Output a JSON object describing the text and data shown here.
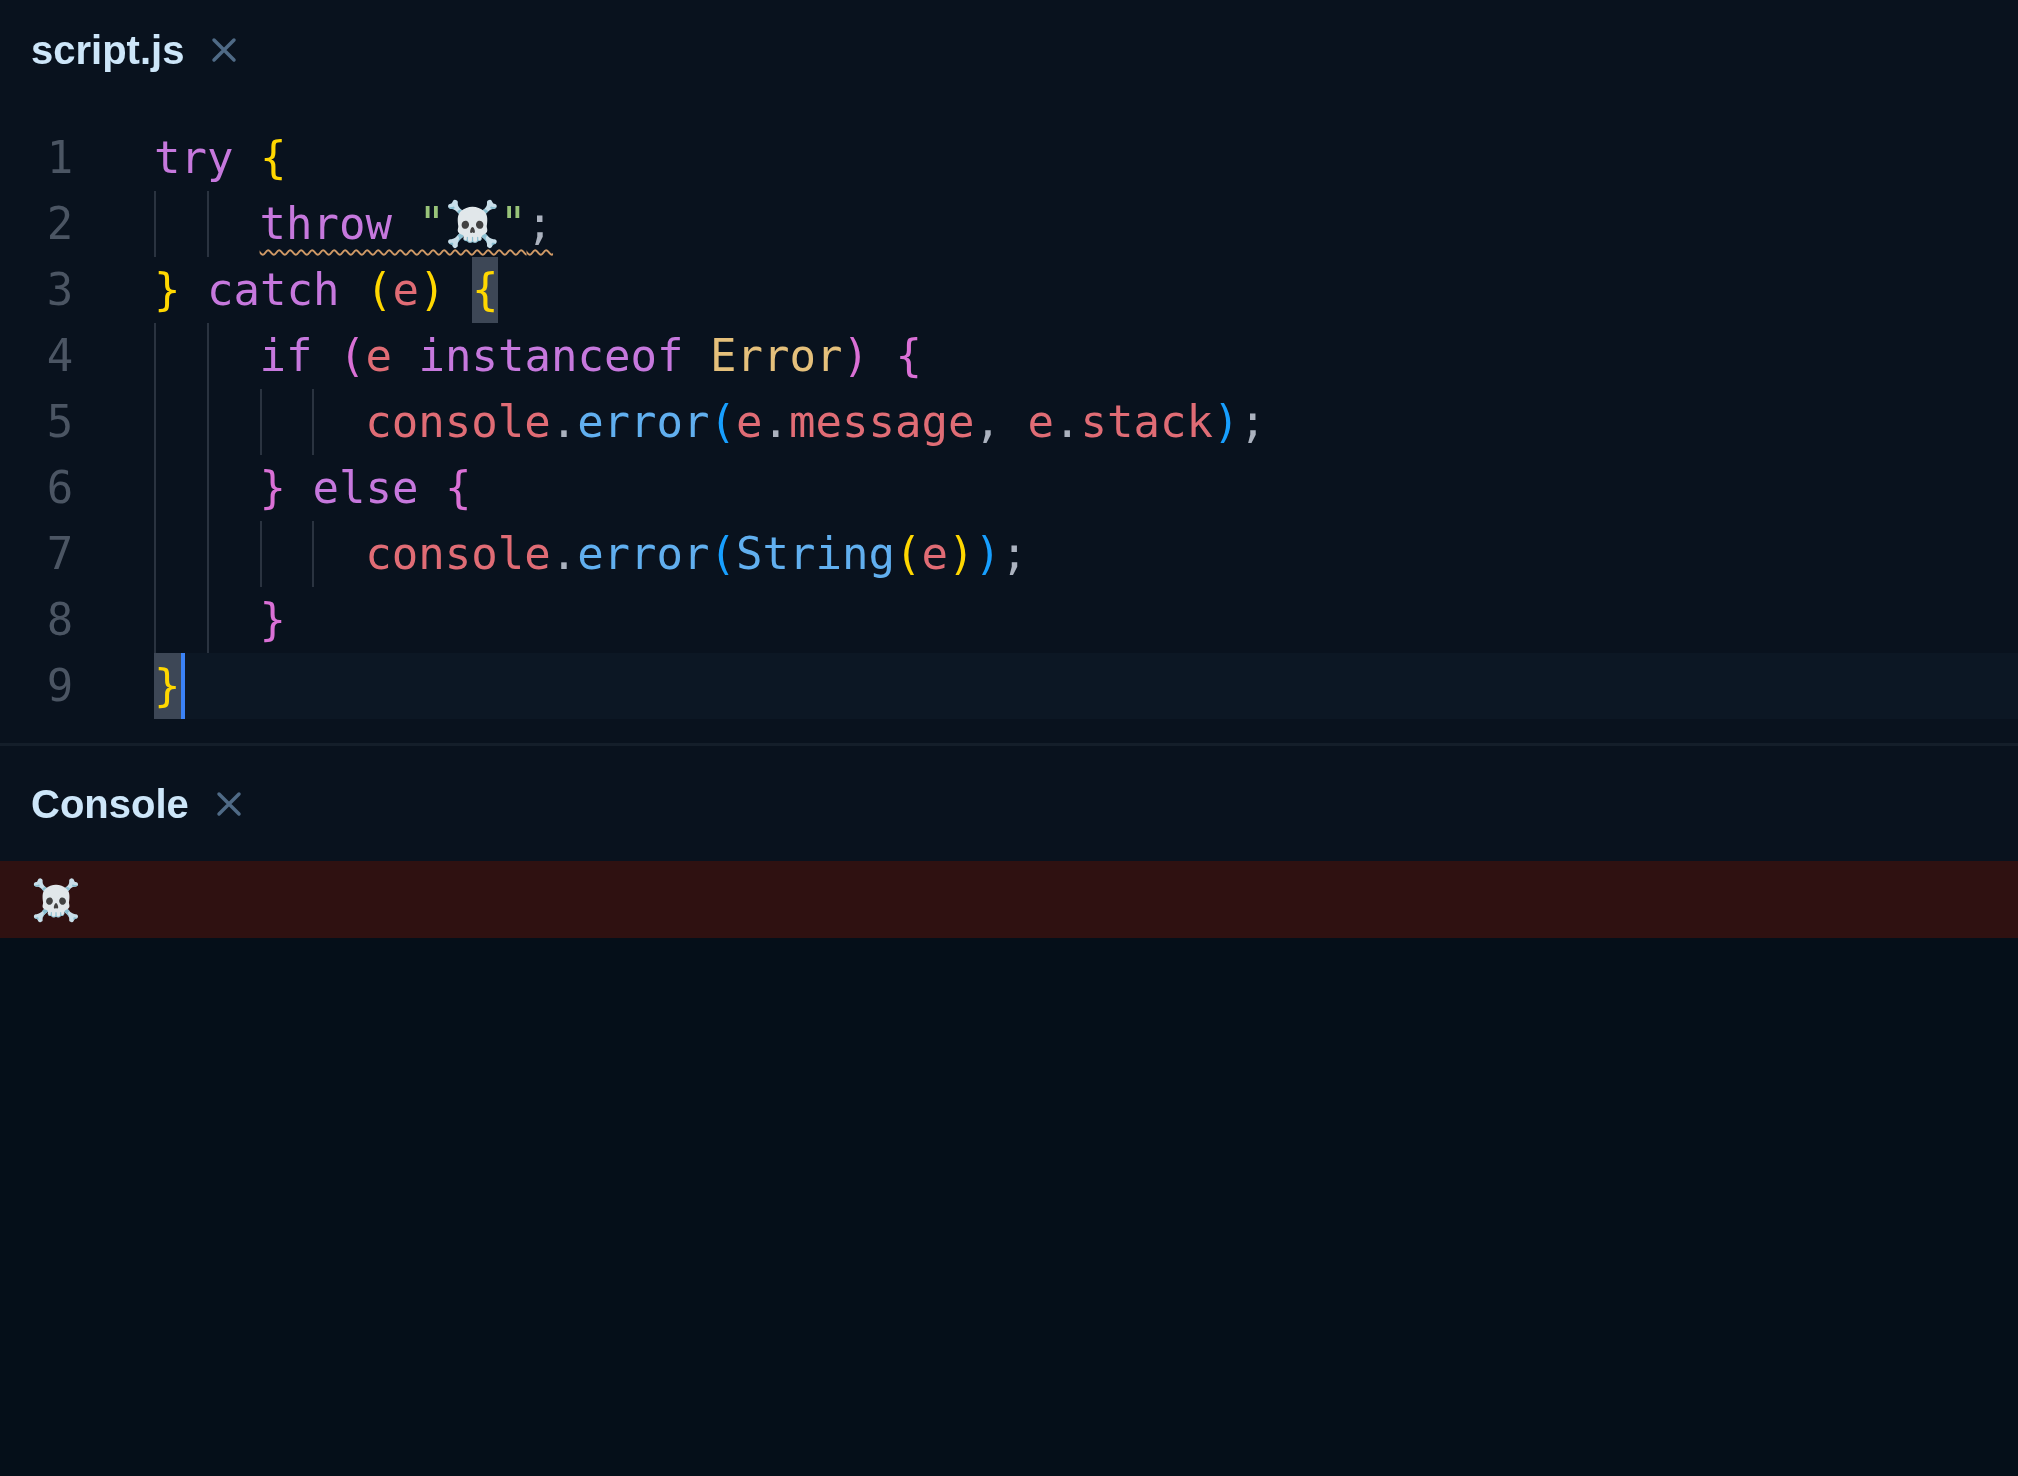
{
  "editor_tab": {
    "title": "script.js"
  },
  "lines": [
    {
      "number": "1",
      "current": false,
      "tokens": [
        {
          "text": "try",
          "kind": "keyword"
        },
        {
          "text": " {",
          "kind": "bracket1"
        }
      ],
      "children": [
        {
          "number": "2",
          "current": false,
          "tokens": [
            {
              "text": "throw",
              "kind": "keyword",
              "squiggle": true
            },
            {
              "text": " \"☠️\"",
              "kind": "string",
              "squiggle": true
            },
            {
              "text": ";",
              "kind": "punct",
              "squiggle": true
            }
          ]
        }
      ]
    },
    {
      "number": "3",
      "current": false,
      "tokens": [
        {
          "text": "}",
          "kind": "bracket1"
        },
        {
          "text": " catch",
          "kind": "keyword"
        },
        {
          "text": " (",
          "kind": "bracket1"
        },
        {
          "text": "e",
          "kind": "variable"
        },
        {
          "text": ") ",
          "kind": "bracket1"
        },
        {
          "text": "{",
          "kind": "bracket1",
          "matched": true
        }
      ],
      "children": [
        {
          "number": "4",
          "current": false,
          "tokens": [
            {
              "text": "if",
              "kind": "keyword"
            },
            {
              "text": " (",
              "kind": "bracket2"
            },
            {
              "text": "e",
              "kind": "variable"
            },
            {
              "text": " instanceof",
              "kind": "keyword"
            },
            {
              "text": " Error",
              "kind": "class"
            },
            {
              "text": ")",
              "kind": "bracket2"
            },
            {
              "text": " {",
              "kind": "bracket2"
            }
          ],
          "children": [
            {
              "number": "5",
              "current": false,
              "tokens": [
                {
                  "text": "console",
                  "kind": "variable"
                },
                {
                  "text": ".",
                  "kind": "punct"
                },
                {
                  "text": "error",
                  "kind": "function"
                },
                {
                  "text": "(",
                  "kind": "bracket3"
                },
                {
                  "text": "e",
                  "kind": "variable"
                },
                {
                  "text": ".",
                  "kind": "punct"
                },
                {
                  "text": "message",
                  "kind": "variable"
                },
                {
                  "text": ",",
                  "kind": "punct"
                },
                {
                  "text": " e",
                  "kind": "variable"
                },
                {
                  "text": ".",
                  "kind": "punct"
                },
                {
                  "text": "stack",
                  "kind": "variable"
                },
                {
                  "text": ")",
                  "kind": "bracket3"
                },
                {
                  "text": ";",
                  "kind": "punct"
                }
              ]
            }
          ]
        },
        {
          "number": "6",
          "current": false,
          "tokens": [
            {
              "text": "}",
              "kind": "bracket2"
            },
            {
              "text": " else",
              "kind": "keyword"
            },
            {
              "text": " {",
              "kind": "bracket2"
            }
          ],
          "children": [
            {
              "number": "7",
              "current": false,
              "tokens": [
                {
                  "text": "console",
                  "kind": "variable"
                },
                {
                  "text": ".",
                  "kind": "punct"
                },
                {
                  "text": "error",
                  "kind": "function"
                },
                {
                  "text": "(",
                  "kind": "bracket3"
                },
                {
                  "text": "String",
                  "kind": "function"
                },
                {
                  "text": "(",
                  "kind": "bracket1"
                },
                {
                  "text": "e",
                  "kind": "variable"
                },
                {
                  "text": ")",
                  "kind": "bracket1"
                },
                {
                  "text": ")",
                  "kind": "bracket3"
                },
                {
                  "text": ";",
                  "kind": "punct"
                }
              ]
            }
          ]
        },
        {
          "number": "8",
          "current": false,
          "tokens": [
            {
              "text": "}",
              "kind": "bracket2"
            }
          ]
        }
      ]
    },
    {
      "number": "9",
      "current": true,
      "tokens": [
        {
          "text": "}",
          "kind": "bracket1",
          "matched": true
        }
      ]
    }
  ],
  "console_tab": {
    "title": "Console"
  },
  "console_entries": [
    {
      "kind": "error",
      "text": "☠️"
    }
  ]
}
